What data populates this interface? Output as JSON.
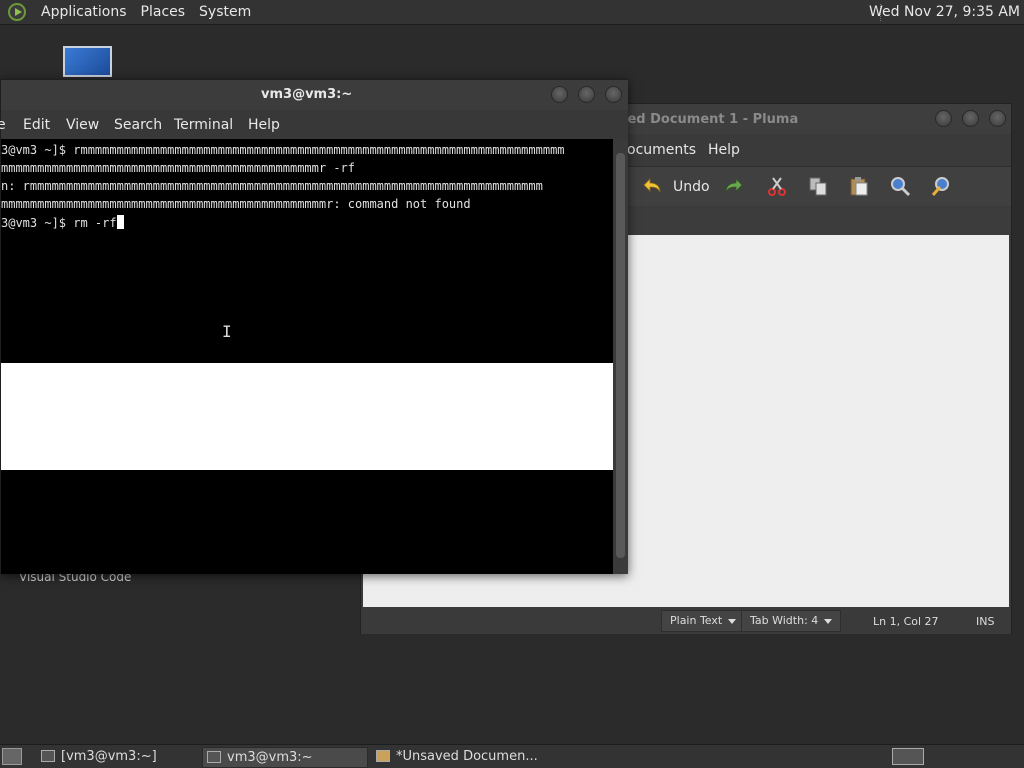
{
  "top_panel": {
    "menus": [
      "Applications",
      "Places",
      "System"
    ],
    "clock": "Wed Nov 27,  9:35 AM"
  },
  "desktop": {
    "vscode_label": "Visual Studio Code"
  },
  "pluma": {
    "title": "ved Document 1 - Pluma",
    "menus": [
      "ocuments",
      "Help"
    ],
    "undo_label": "Undo",
    "status": {
      "language": "Plain Text",
      "tab_width": "Tab Width:  4",
      "position": "Ln 1, Col 27",
      "mode": "INS"
    }
  },
  "terminal": {
    "title": "vm3@vm3:~",
    "menus": [
      "e",
      "Edit",
      "View",
      "Search",
      "Terminal",
      "Help"
    ],
    "lines": [
      "3@vm3 ~]$ rmmmmmmmmmmmmmmmmmmmmmmmmmmmmmmmmmmmmmmmmmmmmmmmmmmmmmmmmmmmmmmmmmmm",
      "mmmmmmmmmmmmmmmmmmmmmmmmmmmmmmmmmmmmmmmmmmmmr -rf",
      "n: rmmmmmmmmmmmmmmmmmmmmmmmmmmmmmmmmmmmmmmmmmmmmmmmmmmmmmmmmmmmmmmmmmmmmmmm",
      "mmmmmmmmmmmmmmmmmmmmmmmmmmmmmmmmmmmmmmmmmmmmmr: command not found",
      "3@vm3 ~]$ rm -rf"
    ]
  },
  "taskbar": {
    "tasks": [
      "[vm3@vm3:~]",
      "vm3@vm3:~",
      "*Unsaved Documen..."
    ]
  },
  "colors": {
    "terminal_bg": "#000000",
    "panel_bg": "#333333",
    "editor_bg": "#eeeeee"
  }
}
